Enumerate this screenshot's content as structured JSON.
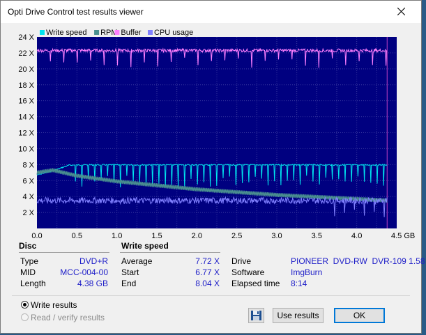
{
  "window": {
    "title": "Opti Drive Control test results viewer"
  },
  "legend": [
    {
      "label": "Write speed",
      "color": "#00e5ee"
    },
    {
      "label": "RPM",
      "color": "#4a8f8f"
    },
    {
      "label": "Buffer",
      "color": "#ff7fff"
    },
    {
      "label": "CPU usage",
      "color": "#8080ff"
    }
  ],
  "chart_data": {
    "type": "line",
    "ylim": [
      0,
      24
    ],
    "xlim": [
      0,
      4.5
    ],
    "y_ticks": [
      "2 X",
      "4 X",
      "6 X",
      "8 X",
      "10 X",
      "12 X",
      "14 X",
      "16 X",
      "18 X",
      "20 X",
      "22 X",
      "24 X"
    ],
    "x_ticks": [
      "0.0",
      "0.5",
      "1.0",
      "1.5",
      "2.0",
      "2.5",
      "3.0",
      "3.5",
      "4.0",
      "4.5 GB"
    ],
    "grid": true,
    "series": [
      {
        "name": "Write speed",
        "x": [
          0.0,
          0.2,
          0.4,
          0.6,
          4.38
        ],
        "y": [
          6.77,
          7.3,
          8.0,
          8.04,
          8.04
        ]
      },
      {
        "name": "RPM",
        "x": [
          0.0,
          0.2,
          0.5,
          1.0,
          2.0,
          3.0,
          4.0,
          4.38
        ],
        "y": [
          7.0,
          7.3,
          6.6,
          5.9,
          4.9,
          4.2,
          3.7,
          3.5
        ]
      },
      {
        "name": "Buffer",
        "x": [
          0.0,
          4.38
        ],
        "y": [
          22.3,
          22.3
        ]
      },
      {
        "name": "CPU usage",
        "x": [
          0.0,
          4.38
        ],
        "y": [
          3.5,
          3.5
        ]
      }
    ]
  },
  "disc": {
    "heading": "Disc",
    "type_label": "Type",
    "type_value": "DVD+R",
    "mid_label": "MID",
    "mid_value": "MCC-004-00",
    "length_label": "Length",
    "length_value": "4.38 GB"
  },
  "write_speed": {
    "heading": "Write speed",
    "average_label": "Average",
    "average_value": "7.72 X",
    "start_label": "Start",
    "start_value": "6.77 X",
    "end_label": "End",
    "end_value": "8.04 X"
  },
  "drive_info": {
    "drive_label": "Drive",
    "drive_value": "PIONEER  DVD-RW  DVR-109 1.58",
    "software_label": "Software",
    "software_value": "ImgBurn",
    "elapsed_label": "Elapsed time",
    "elapsed_value": "8:14"
  },
  "options": {
    "write_results": "Write results",
    "read_verify_results": "Read / verify results"
  },
  "buttons": {
    "use_results": "Use results",
    "ok": "OK"
  }
}
